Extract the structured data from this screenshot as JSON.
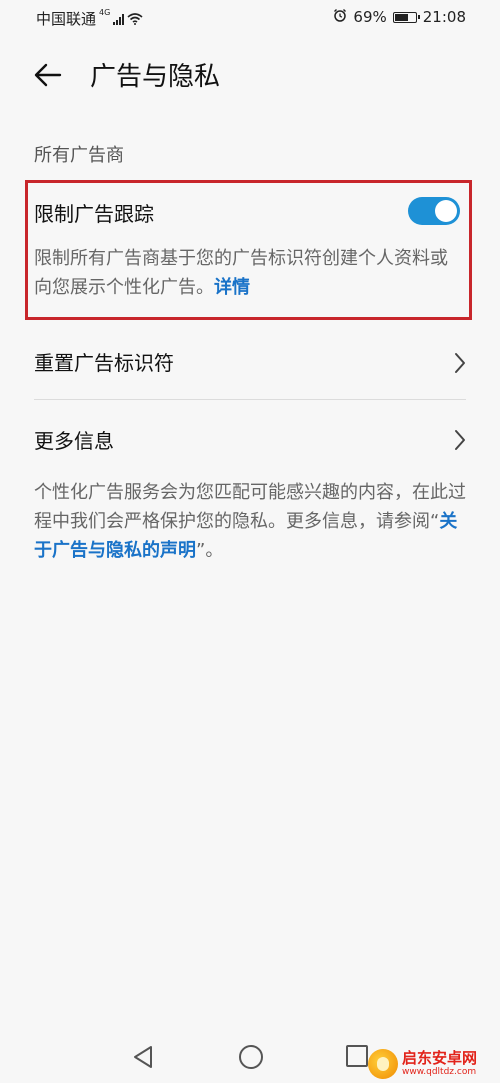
{
  "status_bar": {
    "carrier": "中国联通",
    "network_type": "4G",
    "battery": "69%",
    "time": "21:08",
    "icons": [
      "signal-icon",
      "wifi-icon",
      "alarm-icon",
      "battery-icon"
    ]
  },
  "header": {
    "title": "广告与隐私"
  },
  "section": {
    "label": "所有广告商"
  },
  "limit_tracking": {
    "title": "限制广告跟踪",
    "toggle_on": true,
    "description": "限制所有广告商基于您的广告标识符创建个人资料或向您展示个性化广告。",
    "link_label": "详情",
    "highlight_color": "#c8262b"
  },
  "rows": [
    {
      "label": "重置广告标识符"
    },
    {
      "label": "更多信息"
    }
  ],
  "footer": {
    "text_before": "个性化广告服务会为您匹配可能感兴趣的内容，在此过程中我们会严格保护您的隐私。更多信息，请参阅“",
    "link_label": "关于广告与隐私的声明",
    "text_after": "”。"
  },
  "colors": {
    "accent": "#1e91d6",
    "link": "#1a73c8"
  },
  "watermark": {
    "title": "启东安卓网",
    "url": "www.qdltdz.com"
  }
}
